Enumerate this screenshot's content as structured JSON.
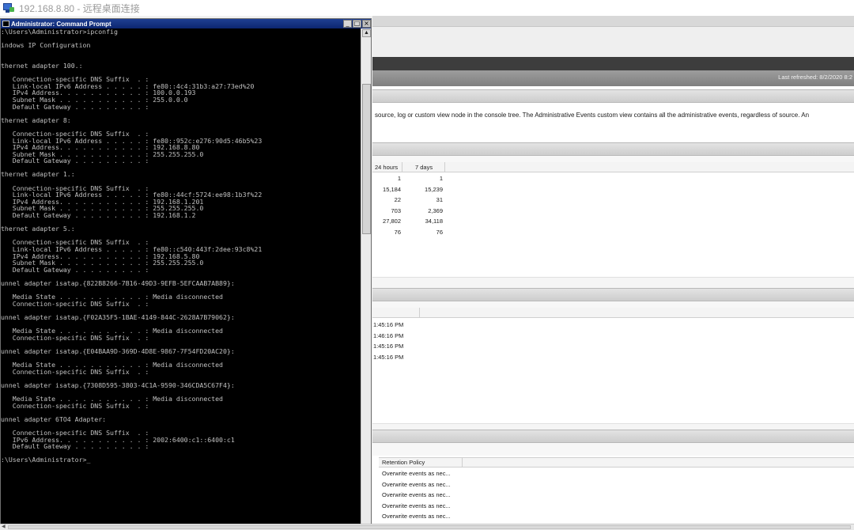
{
  "rdp": {
    "title": "192.168.8.80 - 远程桌面连接",
    "icon": "remote-desktop-icon"
  },
  "cmd": {
    "title": "Administrator: Command Prompt",
    "buttons": {
      "minimize": "_",
      "maximize": "□",
      "close": "×"
    },
    "scroll_up": "▲",
    "lines": [
      ":\\Users\\Administrator>ipconfig",
      "",
      "indows IP Configuration",
      "",
      "",
      "thernet adapter 100.:",
      "",
      "   Connection-specific DNS Suffix  . :",
      "   Link-local IPv6 Address . . . . . : fe80::4c4:31b3:a27:73ed%20",
      "   IPv4 Address. . . . . . . . . . . : 100.0.0.193",
      "   Subnet Mask . . . . . . . . . . . : 255.0.0.0",
      "   Default Gateway . . . . . . . . . :",
      "",
      "thernet adapter 8:",
      "",
      "   Connection-specific DNS Suffix  . :",
      "   Link-local IPv6 Address . . . . . : fe80::952c:e276:90d5:46b5%23",
      "   IPv4 Address. . . . . . . . . . . : 192.168.8.80",
      "   Subnet Mask . . . . . . . . . . . : 255.255.255.0",
      "   Default Gateway . . . . . . . . . :",
      "",
      "thernet adapter 1.:",
      "",
      "   Connection-specific DNS Suffix  . :",
      "   Link-local IPv6 Address . . . . . : fe80::44cf:5724:ee98:1b3f%22",
      "   IPv4 Address. . . . . . . . . . . : 192.168.1.201",
      "   Subnet Mask . . . . . . . . . . . : 255.255.255.0",
      "   Default Gateway . . . . . . . . . : 192.168.1.2",
      "",
      "thernet adapter 5.:",
      "",
      "   Connection-specific DNS Suffix  . :",
      "   Link-local IPv6 Address . . . . . : fe80::c540:443f:2dee:93c8%21",
      "   IPv4 Address. . . . . . . . . . . : 192.168.5.80",
      "   Subnet Mask . . . . . . . . . . . : 255.255.255.0",
      "   Default Gateway . . . . . . . . . :",
      "",
      "unnel adapter isatap.{822B8266-7B16-49D3-9EFB-5EFCAAB7AB89}:",
      "",
      "   Media State . . . . . . . . . . . : Media disconnected",
      "   Connection-specific DNS Suffix  . :",
      "",
      "unnel adapter isatap.{F02A35F5-1BAE-4149-844C-2628A7B79062}:",
      "",
      "   Media State . . . . . . . . . . . : Media disconnected",
      "   Connection-specific DNS Suffix  . :",
      "",
      "unnel adapter isatap.{E04BAA9D-369D-4D8E-9867-7F54FD20AC20}:",
      "",
      "   Media State . . . . . . . . . . . : Media disconnected",
      "   Connection-specific DNS Suffix  . :",
      "",
      "unnel adapter isatap.{7308D595-3803-4C1A-9590-346CDA5C67F4}:",
      "",
      "   Media State . . . . . . . . . . . : Media disconnected",
      "   Connection-specific DNS Suffix  . :",
      "",
      "unnel adapter 6TO4 Adapter:",
      "",
      "   Connection-specific DNS Suffix  . :",
      "   IPv6 Address. . . . . . . . . . . : 2002:6400:c1::6400:c1",
      "   Default Gateway . . . . . . . . . :",
      "",
      ":\\Users\\Administrator>_"
    ]
  },
  "event_viewer": {
    "last_refreshed": "Last refreshed: 8/2/2020 8:2",
    "description": "source, log or custom view node in the console tree. The Administrative Events custom view contains all the administrative events, regardless of source. An",
    "summary": {
      "headers": [
        "24 hours",
        "7 days"
      ],
      "rows": [
        [
          "1",
          "1"
        ],
        [
          "15,184",
          "15,239"
        ],
        [
          "22",
          "31"
        ],
        [
          "703",
          "2,369"
        ],
        [
          "27,802",
          "34,118"
        ],
        [
          "76",
          "76"
        ]
      ]
    },
    "recent": {
      "rows": [
        "1:45:16 PM",
        "1:46:16 PM",
        "1:45:16 PM",
        "1:45:16 PM"
      ]
    },
    "retention": {
      "header": "Retention Policy",
      "rows": [
        "Overwrite events as nec...",
        "Overwrite events as nec...",
        "Overwrite events as nec...",
        "Overwrite events as nec...",
        "Overwrite events as nec..."
      ]
    }
  },
  "hscroll": {
    "left_arrow": "◀"
  }
}
